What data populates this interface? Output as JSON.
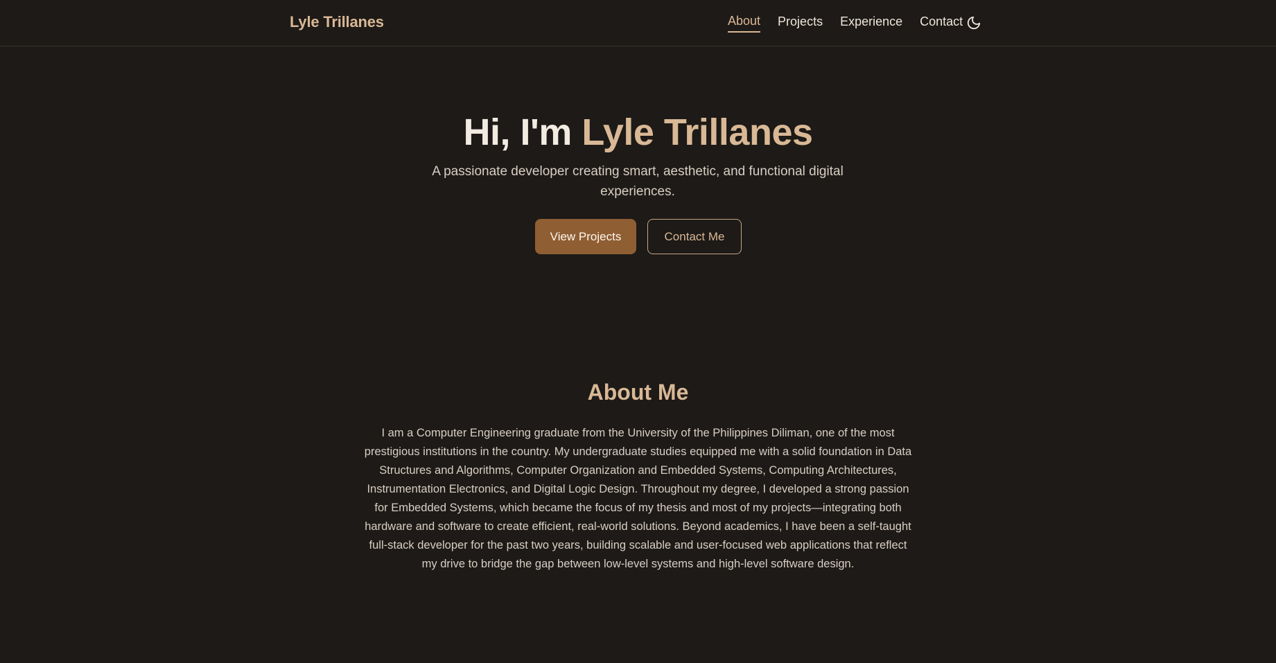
{
  "nav": {
    "brand": "Lyle Trillanes",
    "links": [
      {
        "label": "About",
        "active": true
      },
      {
        "label": "Projects",
        "active": false
      },
      {
        "label": "Experience",
        "active": false
      },
      {
        "label": "Contact",
        "active": false
      }
    ],
    "theme_icon": "moon-icon"
  },
  "hero": {
    "title_prefix": "Hi, I'm ",
    "title_name": "Lyle Trillanes",
    "subtitle": "A passionate developer creating smart, aesthetic, and functional digital experiences.",
    "primary_button": "View Projects",
    "secondary_button": "Contact Me"
  },
  "about": {
    "title": "About Me",
    "body": "I am a Computer Engineering graduate from the University of the Philippines Diliman, one of the most prestigious institutions in the country. My undergraduate studies equipped me with a solid foundation in Data Structures and Algorithms, Computer Organization and Embedded Systems, Computing Architectures, Instrumentation Electronics, and Digital Logic Design. Throughout my degree, I developed a strong passion for Embedded Systems, which became the focus of my thesis and most of my projects—integrating both hardware and software to create efficient, real-world solutions. Beyond academics, I have been a self-taught full-stack developer for the past two years, building scalable and user-focused web applications that reflect my drive to bridge the gap between low-level systems and high-level software design."
  },
  "colors": {
    "background": "#1d1a17",
    "accent": "#d9b896",
    "primary_button": "#8f5e33",
    "text": "#ebe2d6"
  }
}
